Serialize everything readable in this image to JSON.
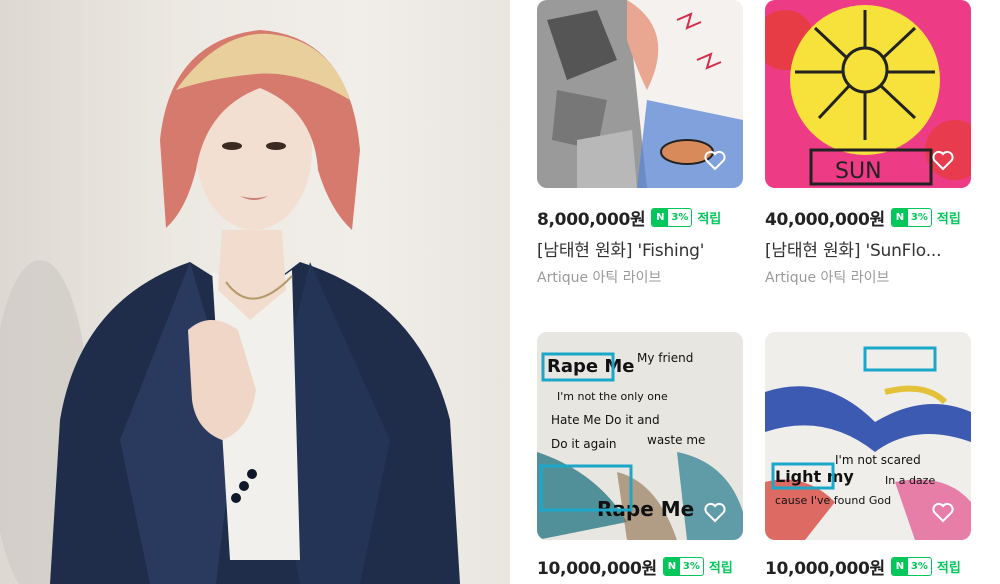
{
  "photo": {
    "alt": ""
  },
  "products": [
    {
      "price": "8,000,000원",
      "npay_badge": "N",
      "npay_rate": "3%",
      "earn_label": "적립",
      "title": "[남태현 원화] 'Fishing'",
      "seller": "Artique 아틱 라이브",
      "art_text": ""
    },
    {
      "price": "40,000,000원",
      "npay_badge": "N",
      "npay_rate": "3%",
      "earn_label": "적립",
      "title": "[남태현 원화] 'SunFlo...",
      "seller": "Artique 아틱 라이브",
      "art_text": "SUN"
    },
    {
      "price": "10,000,000원",
      "npay_badge": "N",
      "npay_rate": "3%",
      "earn_label": "적립",
      "title": "",
      "seller": "",
      "art_text": [
        "Rape Me",
        "My friend",
        "I'm not the only one",
        "Hate Me Do it and",
        "Do it again",
        "waste me",
        "Rape Me"
      ]
    },
    {
      "price": "10,000,000원",
      "npay_badge": "N",
      "npay_rate": "3%",
      "earn_label": "적립",
      "title": "",
      "seller": "",
      "art_text": [
        "I'm not scared",
        "Light my",
        "In a daze",
        "cause I've found God"
      ]
    }
  ]
}
